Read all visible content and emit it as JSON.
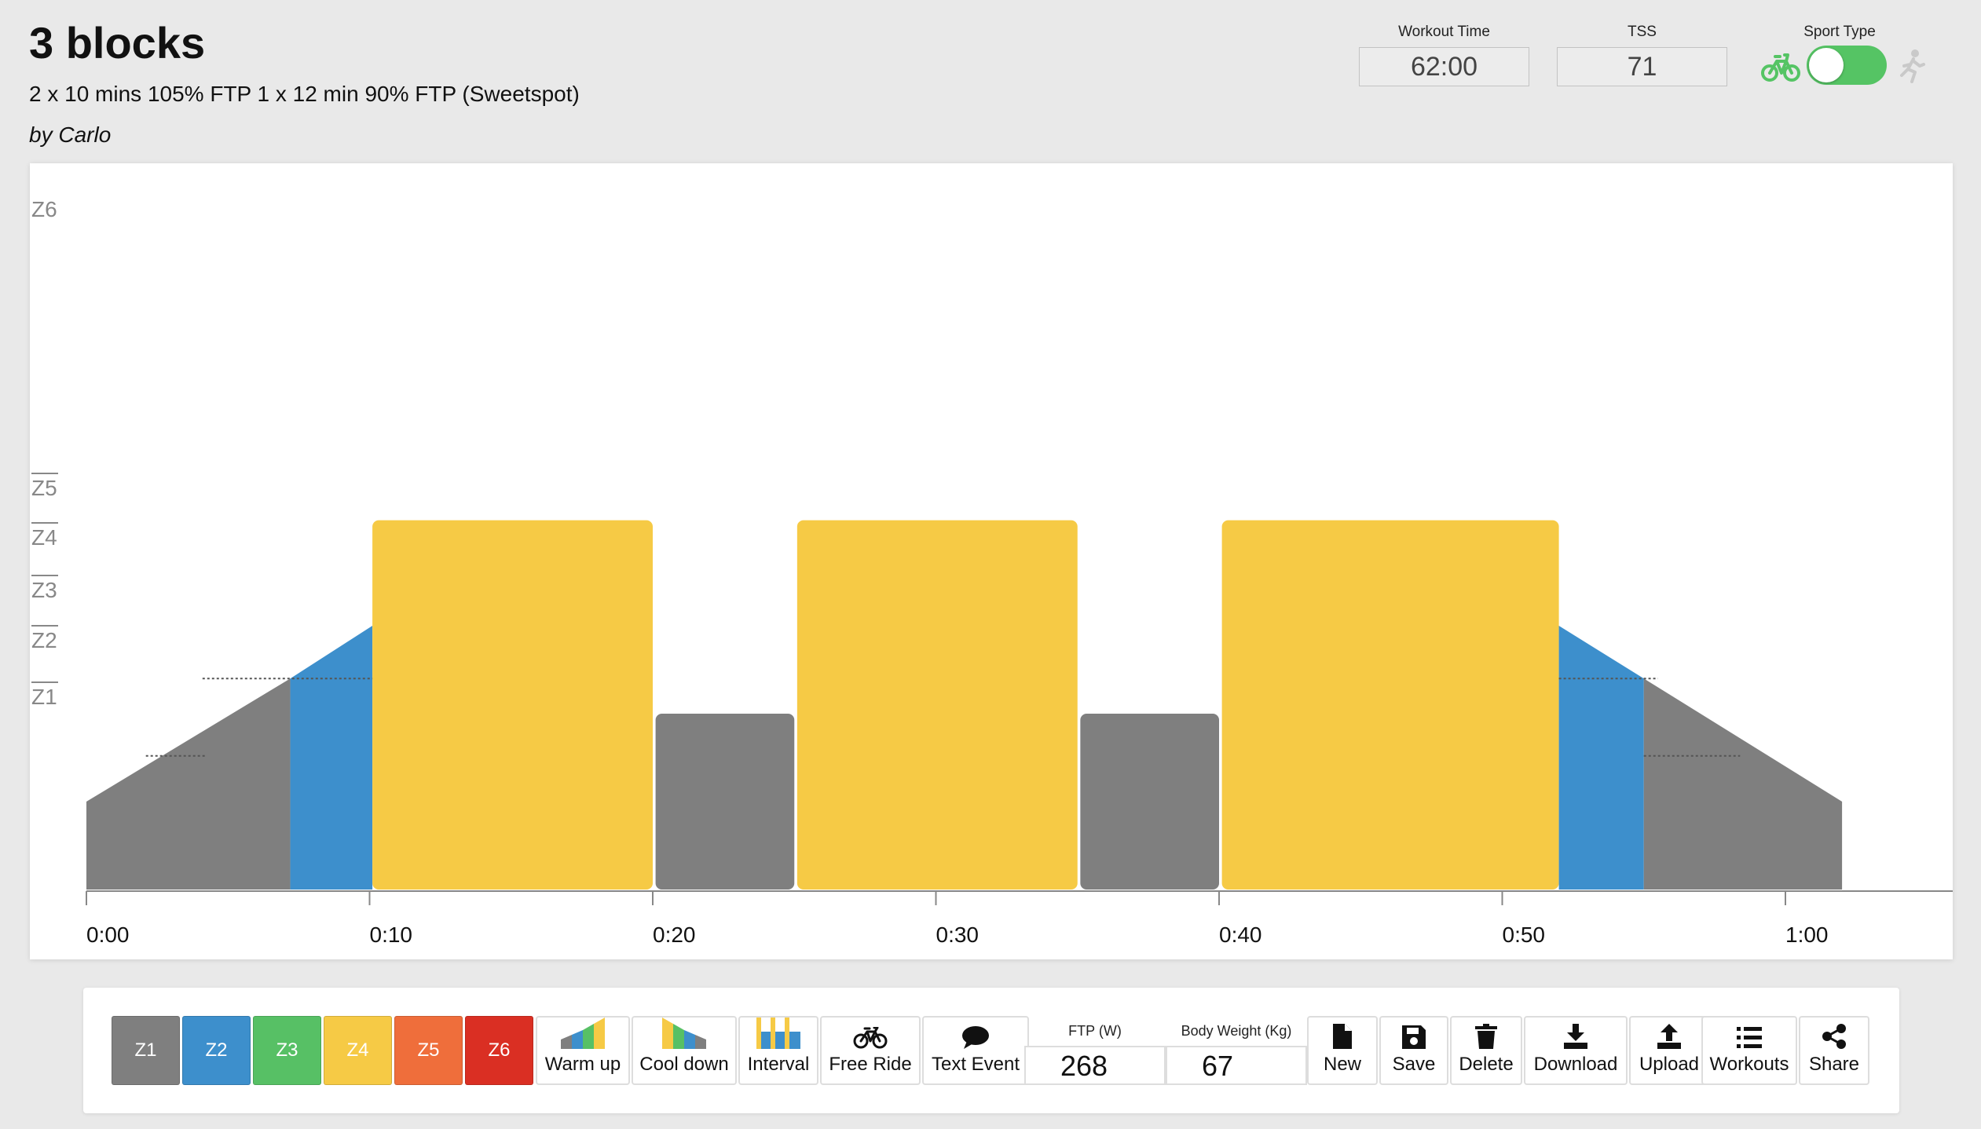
{
  "workout": {
    "title": "3 blocks",
    "description": "2 x 10 mins 105% FTP 1 x 12 min 90% FTP (Sweetspot)",
    "author": "by Carlo"
  },
  "stats": {
    "workout_time_label": "Workout Time",
    "workout_time": "62:00",
    "tss_label": "TSS",
    "tss": "71",
    "sport_type_label": "Sport Type",
    "sport_selected": "bike"
  },
  "chart": {
    "zone_labels": [
      "Z6",
      "Z5",
      "Z4",
      "Z3",
      "Z2",
      "Z1"
    ],
    "tick_labels": [
      "0:00",
      "0:10",
      "0:20",
      "0:30",
      "0:40",
      "0:50",
      "1:00"
    ]
  },
  "chart_data": {
    "type": "bar",
    "x_unit": "minutes",
    "y_unit": "% FTP",
    "segments": [
      {
        "kind": "warmup",
        "start": 0,
        "end": 7.2,
        "from": 25,
        "to": 60,
        "color": "#7f7f7f"
      },
      {
        "kind": "warmup",
        "start": 7.2,
        "end": 10.1,
        "from": 60,
        "to": 75,
        "color": "#3d8fcc"
      },
      {
        "kind": "interval",
        "start": 10.1,
        "end": 20,
        "power": 105,
        "color": "#f6ca45"
      },
      {
        "kind": "interval",
        "start": 20.1,
        "end": 25,
        "power": 50,
        "color": "#7f7f7f"
      },
      {
        "kind": "interval",
        "start": 25.1,
        "end": 35,
        "power": 105,
        "color": "#f6ca45"
      },
      {
        "kind": "interval",
        "start": 35.1,
        "end": 40,
        "power": 50,
        "color": "#7f7f7f"
      },
      {
        "kind": "interval",
        "start": 40.1,
        "end": 52,
        "power": 105,
        "color": "#f6ca45"
      },
      {
        "kind": "cooldown",
        "start": 52,
        "end": 55,
        "from": 75,
        "to": 60,
        "color": "#3d8fcc"
      },
      {
        "kind": "cooldown",
        "start": 55,
        "end": 62,
        "from": 60,
        "to": 25,
        "color": "#7f7f7f"
      }
    ]
  },
  "toolbar": {
    "zones": [
      {
        "label": "Z1",
        "color": "#7f7f7f"
      },
      {
        "label": "Z2",
        "color": "#3d8fcc"
      },
      {
        "label": "Z3",
        "color": "#57c065"
      },
      {
        "label": "Z4",
        "color": "#f6ca45"
      },
      {
        "label": "Z5",
        "color": "#ef6e3b"
      },
      {
        "label": "Z6",
        "color": "#da2f23"
      }
    ],
    "warmup_label": "Warm up",
    "cooldown_label": "Cool down",
    "interval_label": "Interval",
    "freeride_label": "Free Ride",
    "textevent_label": "Text Event",
    "ftp_label": "FTP (W)",
    "ftp_value": "268",
    "weight_label": "Body Weight (Kg)",
    "weight_value": "67",
    "new_label": "New",
    "save_label": "Save",
    "delete_label": "Delete",
    "download_label": "Download",
    "upload_label": "Upload",
    "workouts_label": "Workouts",
    "share_label": "Share"
  }
}
